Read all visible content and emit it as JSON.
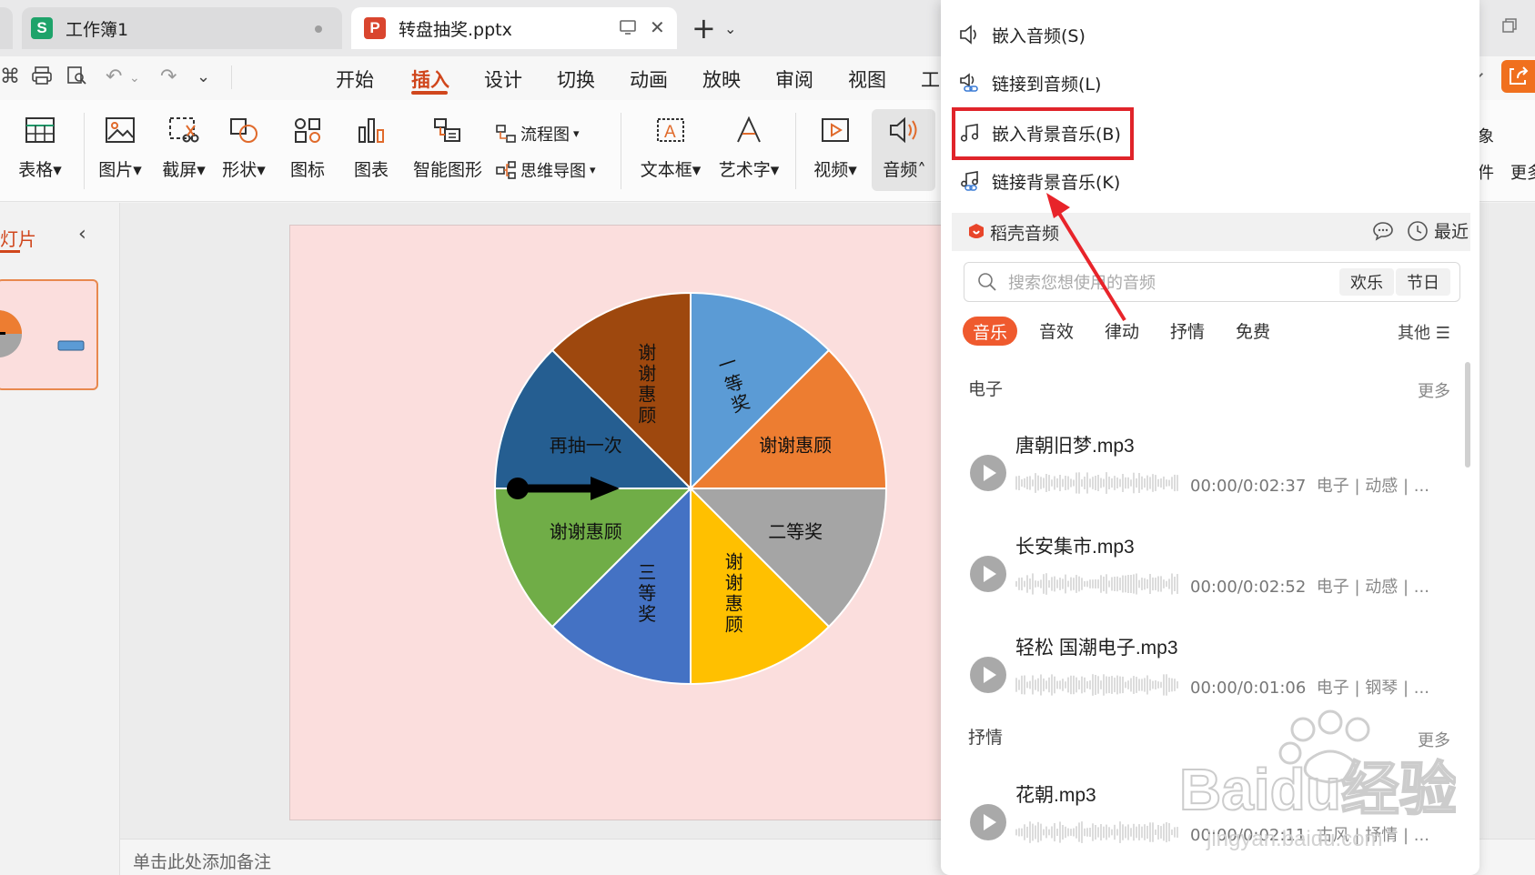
{
  "tabs": [
    {
      "label": "工作簿1",
      "icon": "S"
    },
    {
      "label": "转盘抽奖.pptx",
      "icon": "P"
    }
  ],
  "menu": {
    "items": [
      "开始",
      "插入",
      "设计",
      "切换",
      "动画",
      "放映",
      "审阅",
      "视图",
      "工"
    ],
    "active": "插入"
  },
  "ribbon": {
    "table": "表格",
    "picture": "图片",
    "screenshot": "截屏",
    "shape": "形状",
    "icon": "图标",
    "chart": "图表",
    "smartart": "智能图形",
    "flowchart": "流程图",
    "mindmap": "思维导图",
    "textbox": "文本框",
    "wordart": "艺术字",
    "video": "视频",
    "audio": "音频",
    "right1": "象",
    "right2": "件",
    "right3": "更多"
  },
  "left_panel": {
    "tab": "灯片"
  },
  "wheel": {
    "segments": [
      {
        "label": "一等奖",
        "color": "#5b9bd5",
        "value": 1
      },
      {
        "label": "谢谢惠顾",
        "color": "#ed7d31",
        "value": 1
      },
      {
        "label": "二等奖",
        "color": "#a5a5a5",
        "value": 1
      },
      {
        "label": "谢谢惠顾",
        "color": "#ffc000",
        "value": 1
      },
      {
        "label": "三等奖",
        "color": "#4472c4",
        "value": 1
      },
      {
        "label": "谢谢惠顾",
        "color": "#70ad47",
        "value": 1
      },
      {
        "label": "再抽一次",
        "color": "#255e91",
        "value": 1
      },
      {
        "label": "谢谢惠顾",
        "color": "#9e480e",
        "value": 1
      }
    ]
  },
  "notes": {
    "placeholder": "单击此处添加备注"
  },
  "dropdown": {
    "items": [
      {
        "label": "嵌入音频(S)",
        "icon": "speaker-icon"
      },
      {
        "label": "链接到音频(L)",
        "icon": "speaker-link-icon"
      },
      {
        "label": "嵌入背景音乐(B)",
        "icon": "music-note-icon"
      },
      {
        "label": "链接背景音乐(K)",
        "icon": "music-link-icon"
      }
    ],
    "daoke": {
      "title": "稻壳音频",
      "recent": "最近",
      "search_placeholder": "搜索您想使用的音频",
      "chips": [
        "欢乐",
        "节日"
      ],
      "categories": [
        "音乐",
        "音效",
        "律动",
        "抒情",
        "免费"
      ],
      "other": "其他"
    },
    "sections": [
      {
        "title": "电子",
        "more": "更多",
        "tracks": [
          {
            "name": "唐朝旧梦.mp3",
            "time": "00:00/0:02:37",
            "tags": "电子 | 动感 | ..."
          },
          {
            "name": "长安集市.mp3",
            "time": "00:00/0:02:52",
            "tags": "电子 | 动感 | ..."
          },
          {
            "name": "轻松 国潮电子.mp3",
            "time": "00:00/0:01:06",
            "tags": "电子 | 钢琴 | ..."
          }
        ]
      },
      {
        "title": "抒情",
        "more": "更多",
        "tracks": [
          {
            "name": "花朝.mp3",
            "time": "00:00/0:02:11",
            "tags": "古风 | 抒情 | ..."
          }
        ]
      }
    ]
  },
  "watermark": {
    "text": "Baidu经验",
    "subtext": "jingyan.baidu.com"
  },
  "colors": {
    "accent": "#d0461c",
    "highlight": "#e0242a",
    "slide_bg": "#fbdedd"
  }
}
